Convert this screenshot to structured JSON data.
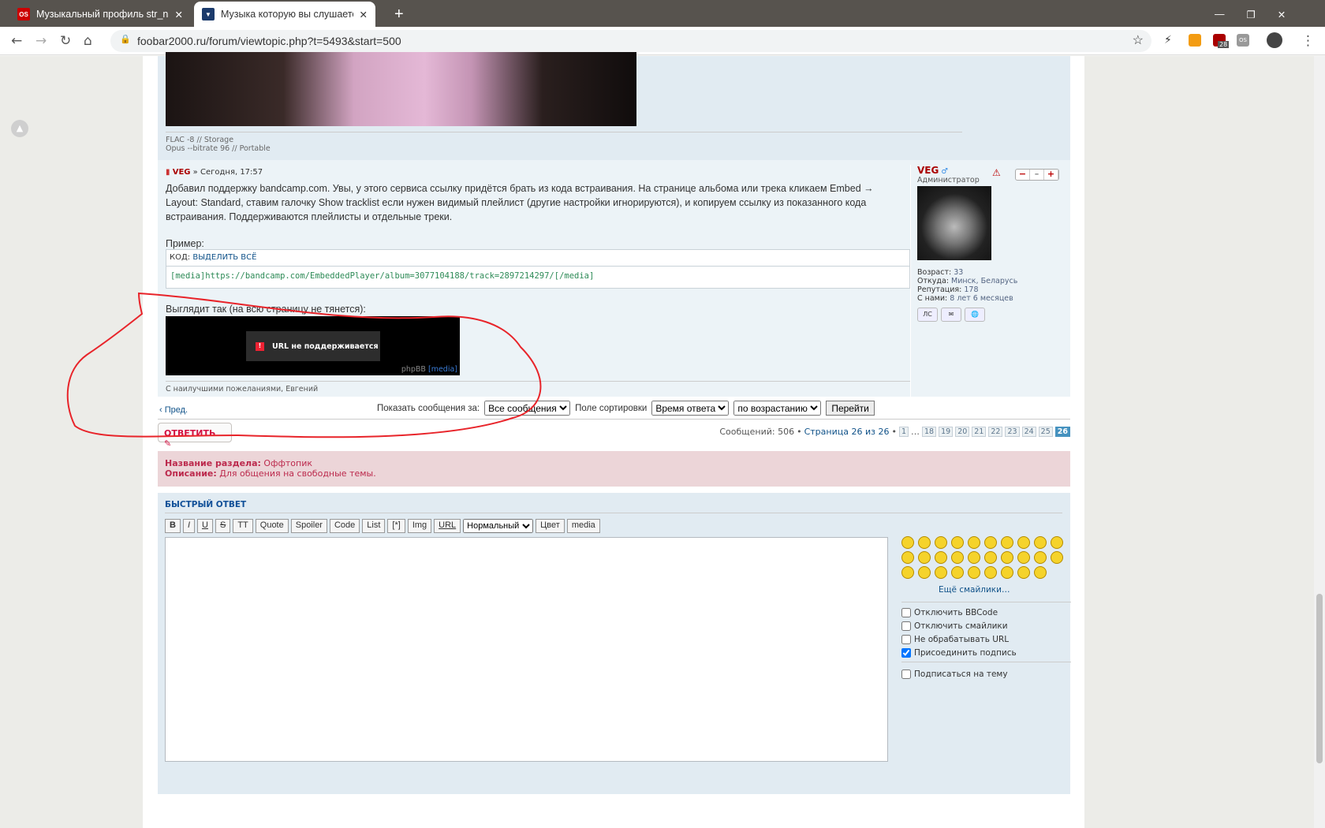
{
  "browser": {
    "tabs": [
      {
        "title": "Музыкальный профиль str_na_la",
        "favicon": "os"
      },
      {
        "title": "Музыка которую вы слушаете с",
        "favicon": "foobar"
      }
    ],
    "url": "foobar2000.ru/forum/viewtopic.php?t=5493&start=500",
    "ext_badge": "28",
    "ext_os": "OS"
  },
  "post1": {
    "signature": [
      "FLAC -8 // Storage",
      "Opus --bitrate 96 // Portable"
    ]
  },
  "post2": {
    "author": "VEG",
    "sep": "»",
    "time": "Сегодня, 17:57",
    "body": [
      "Добавил поддержку bandcamp.com. Увы, у этого сервиса ссылку придётся брать из кода встраивания. На странице альбома или трека кликаем Embed → Layout: Standard, ставим галочку Show tracklist если нужен видимый плейлист (другие настройки игнорируются), и копируем ссылку из показанного кода встраивания. Поддерживаются плейлисты и отдельные треки."
    ],
    "example_label": "Пример:",
    "code_label": "Код:",
    "select_all": "Выделить всё",
    "code": "[media]https://bandcamp.com/EmbeddedPlayer/album=3077104188/track=2897214297/[/media]",
    "looks_label": "Выглядит так (на всю страницу не тянется):",
    "player_error": "URL не поддерживается",
    "player_brand": "phpBB",
    "player_tag": "[media]",
    "signature": "С наилучшими пожеланиями, Евгений",
    "votes": [
      "−",
      "–",
      "+"
    ]
  },
  "profile": {
    "name": "VEG",
    "gender": "♂",
    "rank": "Администратор",
    "fields": [
      {
        "k": "Возраст:",
        "v": "33"
      },
      {
        "k": "Откуда:",
        "v": "Минск, Беларусь"
      },
      {
        "k": "Репутация:",
        "v": "178"
      },
      {
        "k": "С нами:",
        "v": "8 лет 6 месяцев"
      }
    ],
    "buttons": [
      "ЛС",
      "✉",
      "🌐"
    ]
  },
  "sortbar": {
    "prev": "Пред.",
    "show_label": "Показать сообщения за:",
    "show_value": "Все сообщения",
    "sort_label": "Поле сортировки",
    "sort_value": "Время ответа",
    "order_value": "по возрастанию",
    "go": "Перейти"
  },
  "reply_button": "ОТВЕТИТЬ",
  "pagination": {
    "count": "Сообщений: 506",
    "page_text": "Страница 26 из 26",
    "pages": [
      "1",
      "…",
      "18",
      "19",
      "20",
      "21",
      "22",
      "23",
      "24",
      "25",
      "26"
    ],
    "current": "26"
  },
  "forum_info": {
    "name_label": "Название раздела:",
    "name": "Оффтопик",
    "desc_label": "Описание:",
    "desc": "Для общения на свободные темы."
  },
  "quick_reply": {
    "title": "БЫСТРЫЙ ОТВЕТ",
    "toolbar": [
      "B",
      "I",
      "U",
      "S",
      "TT",
      "Quote",
      "Spoiler",
      "Code",
      "List",
      "[*]",
      "Img",
      "URL"
    ],
    "size_value": "Нормальный",
    "toolbar2": [
      "Цвет",
      "media"
    ],
    "more_smilies": "Ещё смайлики…",
    "options": [
      {
        "label": "Отключить BBCode",
        "checked": false
      },
      {
        "label": "Отключить смайлики",
        "checked": false
      },
      {
        "label": "Не обрабатывать URL",
        "checked": false
      },
      {
        "label": "Присоединить подпись",
        "checked": true
      }
    ],
    "subscribe": "Подписаться на тему"
  },
  "colors": {
    "accent": "#105289",
    "author": "#aa0000",
    "annotation": "#e8242a"
  }
}
